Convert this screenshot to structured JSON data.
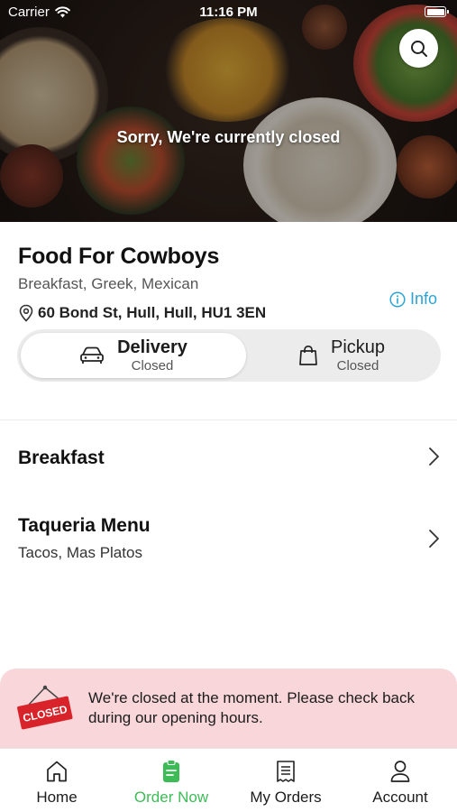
{
  "status_bar": {
    "carrier": "Carrier",
    "time": "11:16 PM"
  },
  "hero": {
    "closed_message": "Sorry, We're currently closed"
  },
  "restaurant": {
    "name": "Food For Cowboys",
    "cuisines": "Breakfast, Greek, Mexican",
    "address": "60 Bond St, Hull, Hull, HU1 3EN",
    "info_label": "Info"
  },
  "order_type": {
    "options": [
      {
        "label": "Delivery",
        "status": "Closed",
        "selected": true
      },
      {
        "label": "Pickup",
        "status": "Closed",
        "selected": false
      }
    ]
  },
  "menus": [
    {
      "title": "Breakfast",
      "subtitle": ""
    },
    {
      "title": "Taqueria Menu",
      "subtitle": "Tacos, Mas Platos"
    }
  ],
  "closed_banner": {
    "sign_text": "CLOSED",
    "message": "We're closed at the moment. Please check back during our opening hours."
  },
  "tabs": [
    {
      "label": "Home",
      "icon": "home-icon",
      "active": false
    },
    {
      "label": "Order Now",
      "icon": "order-icon",
      "active": true
    },
    {
      "label": "My Orders",
      "icon": "receipt-icon",
      "active": false
    },
    {
      "label": "Account",
      "icon": "user-icon",
      "active": false
    }
  ],
  "colors": {
    "accent_green": "#3dbb57",
    "info_blue": "#2aa3d6",
    "banner_bg": "#f9d6d9",
    "sign_red": "#d8232a"
  }
}
